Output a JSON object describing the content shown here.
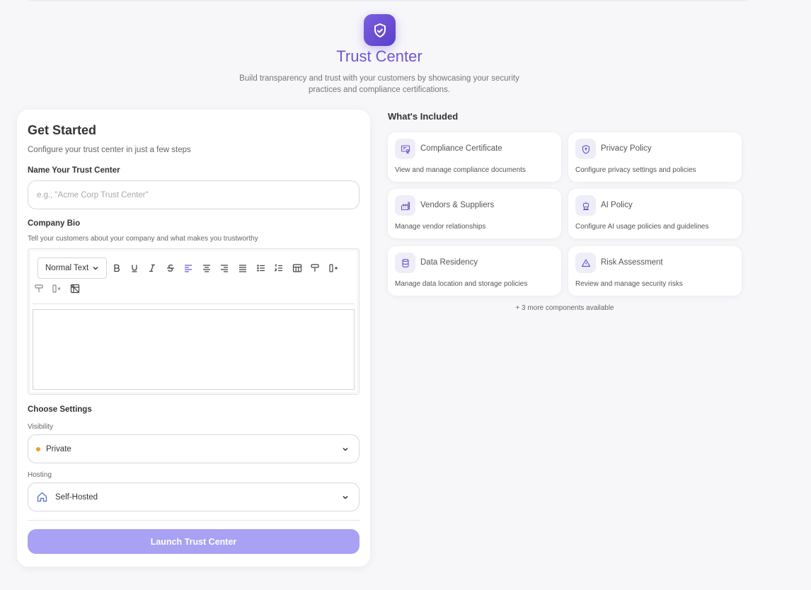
{
  "header": {
    "title": "Trust Center",
    "subtitle": "Build transparency and trust with your customers by showcasing your security practices and compliance certifications.",
    "icon": "shield-check-icon"
  },
  "form": {
    "title": "Get Started",
    "subtitle": "Configure your trust center in just a few steps",
    "name_label": "Name Your Trust Center",
    "name_placeholder": "e.g., \"Acme Corp Trust Center\"",
    "name_value": "",
    "bio_label": "Company Bio",
    "bio_hint": "Tell your customers about your company and what makes you trustworthy",
    "editor": {
      "format_value": "Normal Text",
      "toolbar": [
        "bold",
        "underline",
        "italic",
        "strikethrough",
        "align-left",
        "align-center",
        "align-right",
        "align-justify",
        "bullet-list",
        "numbered-list",
        "table",
        "paint-format",
        "insert-column",
        "clear-format",
        "delete-column",
        "delete-table"
      ],
      "active": "align-left",
      "content": ""
    },
    "settings_label": "Choose Settings",
    "visibility_label": "Visibility",
    "visibility_value": "Private",
    "visibility_dot_color": "#f29b2a",
    "hosting_label": "Hosting",
    "hosting_value": "Self-Hosted",
    "launch_label": "Launch Trust Center"
  },
  "included": {
    "title": "What's Included",
    "items": [
      {
        "title": "Compliance Certificate",
        "desc": "View and manage compliance documents",
        "icon": "certificate-icon"
      },
      {
        "title": "Privacy Policy",
        "desc": "Configure privacy settings and policies",
        "icon": "shield-icon"
      },
      {
        "title": "Vendors & Suppliers",
        "desc": "Manage vendor relationships",
        "icon": "factory-icon"
      },
      {
        "title": "AI Policy",
        "desc": "Configure AI usage policies and guidelines",
        "icon": "robot-icon"
      },
      {
        "title": "Data Residency",
        "desc": "Manage data location and storage policies",
        "icon": "database-icon"
      },
      {
        "title": "Risk Assessment",
        "desc": "Review and manage security risks",
        "icon": "warning-icon"
      }
    ],
    "more_text": "+ 3 more components available"
  },
  "colors": {
    "accent": "#6f55d1",
    "button": "#a9a1f4",
    "background": "#f7f7fa"
  }
}
